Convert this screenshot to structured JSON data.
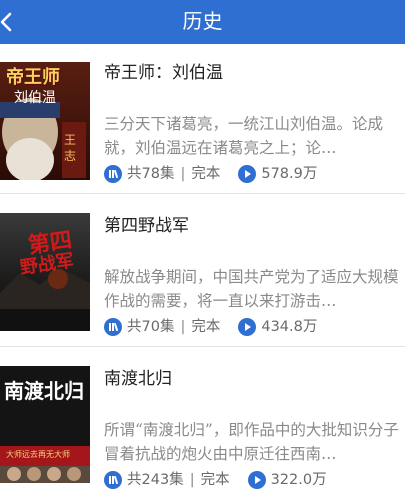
{
  "header": {
    "title": "历史"
  },
  "items": [
    {
      "title": "帝王师：刘伯温",
      "desc": "  三分天下诸葛亮，一统江山刘伯温。论成就，刘伯温远在诸葛亮之上；论…",
      "episodes": "共78集",
      "status": "完本",
      "plays": "578.9万",
      "cover_text": [
        "帝王师",
        "刘伯温"
      ]
    },
    {
      "title": "第四野战军",
      "desc": "解放战争期间，中国共产党为了适应大规模作战的需要，将一直以来打游击…",
      "episodes": "共70集",
      "status": "完本",
      "plays": "434.8万",
      "cover_text": [
        "第四",
        "野战军"
      ]
    },
    {
      "title": "南渡北归",
      "desc": "所谓“南渡北归”，即作品中的大批知识分子冒着抗战的炮火由中原迁往西南…",
      "episodes": "共243集",
      "status": "完本",
      "plays": "322.0万",
      "cover_text": [
        "南渡北归",
        "大师远去再无大师"
      ]
    }
  ],
  "colors": {
    "header": "#2f6fd1",
    "accent": "#2f6fd1"
  },
  "icons": {
    "back": "chevron-left-icon",
    "episodes": "book-icon",
    "plays": "play-icon"
  }
}
